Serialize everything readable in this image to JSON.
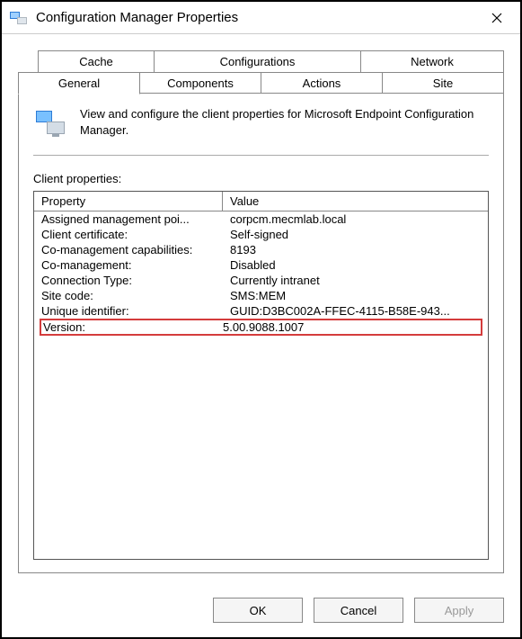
{
  "window": {
    "title": "Configuration Manager Properties"
  },
  "tabs": {
    "top": [
      "Cache",
      "Configurations",
      "Network"
    ],
    "bottom": [
      "General",
      "Components",
      "Actions",
      "Site"
    ],
    "active": "General"
  },
  "description": "View and configure the client properties for Microsoft Endpoint Configuration Manager.",
  "section_label": "Client properties:",
  "columns": {
    "property": "Property",
    "value": "Value"
  },
  "properties": [
    {
      "property": "Assigned management poi...",
      "value": "corpcm.mecmlab.local"
    },
    {
      "property": "Client certificate:",
      "value": "Self-signed"
    },
    {
      "property": "Co-management capabilities:",
      "value": "8193"
    },
    {
      "property": "Co-management:",
      "value": "Disabled"
    },
    {
      "property": "Connection Type:",
      "value": "Currently intranet"
    },
    {
      "property": "Site code:",
      "value": "SMS:MEM"
    },
    {
      "property": "Unique identifier:",
      "value": "GUID:D3BC002A-FFEC-4115-B58E-943..."
    }
  ],
  "highlighted": {
    "property": "Version:",
    "value": "5.00.9088.1007"
  },
  "buttons": {
    "ok": "OK",
    "cancel": "Cancel",
    "apply": "Apply"
  }
}
